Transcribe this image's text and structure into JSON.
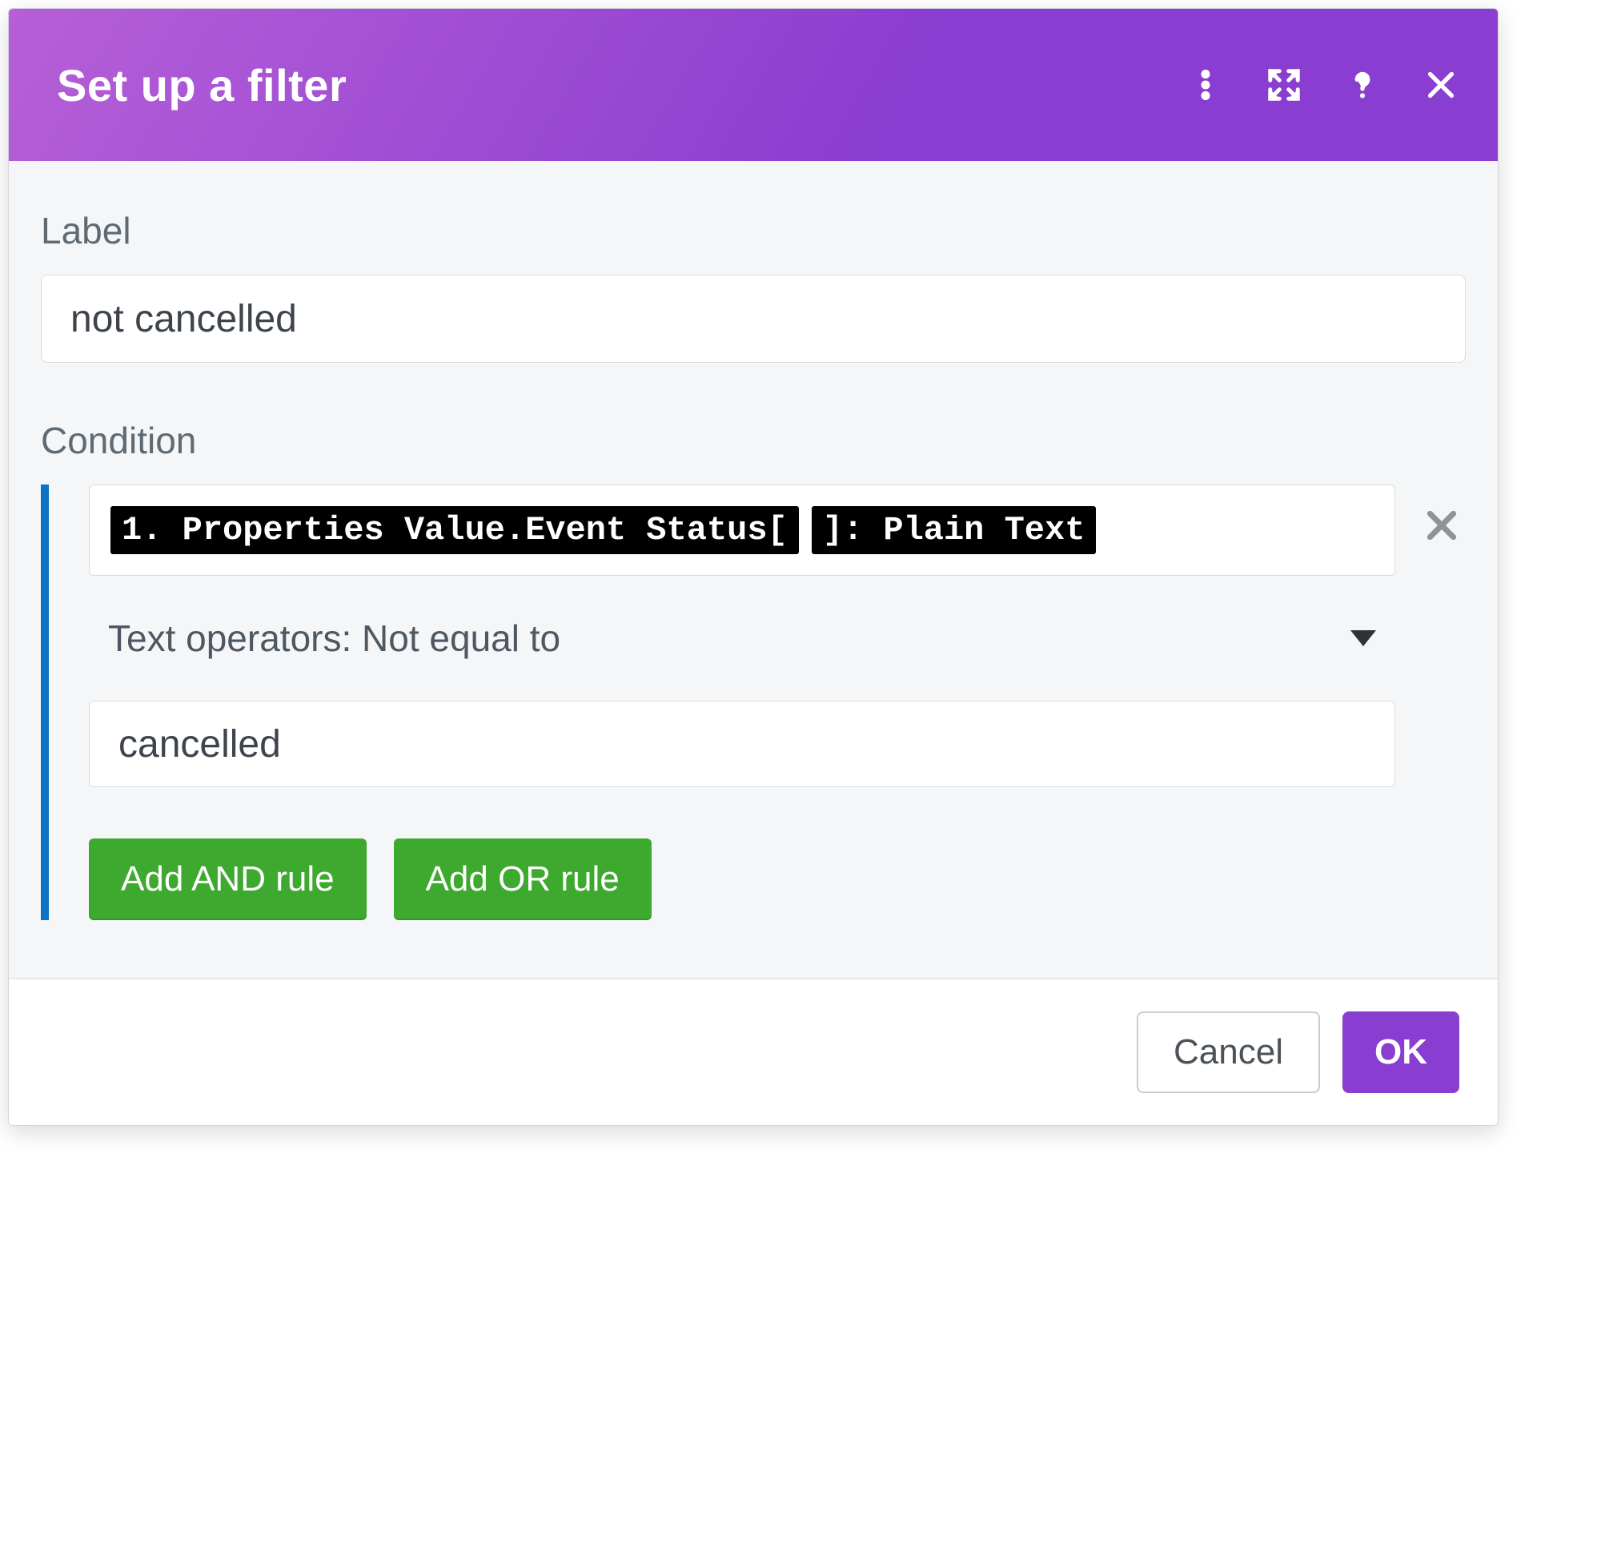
{
  "header": {
    "title": "Set up a filter"
  },
  "body": {
    "label_section_title": "Label",
    "label_value": "not cancelled",
    "condition_section_title": "Condition",
    "rule": {
      "token_line1": "1. Properties Value.Event Status[",
      "token_line2": "]: Plain Text",
      "operator_text": "Text operators: Not equal to",
      "value": "cancelled",
      "add_and_label": "Add AND rule",
      "add_or_label": "Add OR rule"
    }
  },
  "footer": {
    "cancel_label": "Cancel",
    "ok_label": "OK"
  },
  "colors": {
    "header_gradient_start": "#b65fd7",
    "header_gradient_end": "#8a3ed1",
    "rule_accent": "#0b73c6",
    "add_button": "#3ea92f",
    "ok_button": "#8a3ed1"
  }
}
